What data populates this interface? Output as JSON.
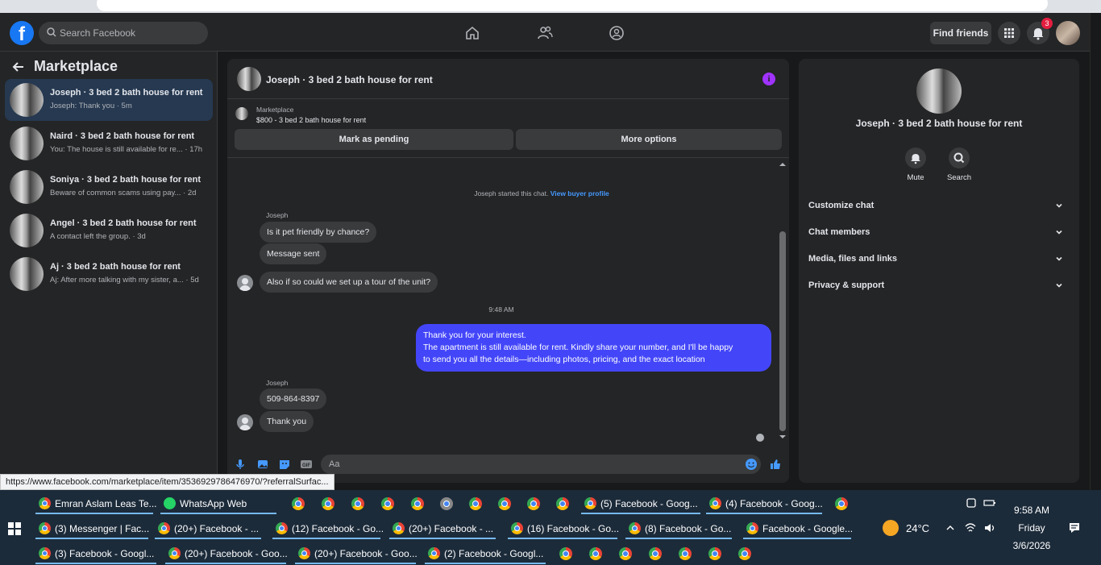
{
  "header": {
    "search_placeholder": "Search Facebook",
    "find_friends": "Find friends",
    "notification_count": "3"
  },
  "sidebar": {
    "title": "Marketplace",
    "items": [
      {
        "name": "Joseph · 3 bed 2 bath house for rent",
        "preview": "Joseph: Thank you · 5m"
      },
      {
        "name": "Naird · 3 bed 2 bath house for rent",
        "preview": "You: The house is still available for re... · 17h"
      },
      {
        "name": "Soniya · 3 bed 2 bath house for rent",
        "preview": "Beware of common scams using pay... · 2d"
      },
      {
        "name": "Angel · 3 bed 2 bath house for rent",
        "preview": "A contact left the group. · 3d"
      },
      {
        "name": "Aj · 3 bed 2 bath house for rent",
        "preview": "Aj: After more talking with my sister, a... · 5d"
      }
    ]
  },
  "chat": {
    "title": "Joseph · 3 bed 2 bath house for rent",
    "marketplace_label": "Marketplace",
    "listing": "$800 - 3 bed 2 bath house for rent",
    "mark_pending": "Mark as pending",
    "more_options": "More options",
    "system_text": "Joseph started this chat.",
    "system_link": "View buyer profile",
    "sender1": "Joseph",
    "msg1": "Is it pet friendly by chance?",
    "msg2": "Message sent",
    "msg3": "Also if so could we set up a tour of the unit?",
    "timestamp": "9:48 AM",
    "outgoing_1": "Thank you for your interest.",
    "outgoing_2": "The apartment is still available for rent. Kindly share your number, and I'll be happy",
    "outgoing_3": "to send you all the details—including photos, pricing, and the exact location",
    "sender2": "Joseph",
    "msg4": "509-864-8397",
    "msg5": "Thank you",
    "composer_placeholder": "Aa"
  },
  "details": {
    "name": "Joseph · 3 bed 2 bath house for rent",
    "mute": "Mute",
    "search": "Search",
    "sections": [
      "Customize chat",
      "Chat members",
      "Media, files and links",
      "Privacy & support"
    ]
  },
  "status_url": "https://www.facebook.com/marketplace/item/3536929786476970/?referralSurfac...",
  "taskbar": {
    "row1": [
      {
        "label": "Emran Aslam Leas Te..."
      },
      {
        "label": "WhatsApp Web"
      },
      {
        "label": "(5) Facebook - Goog..."
      },
      {
        "label": "(4) Facebook - Goog..."
      }
    ],
    "row2": [
      {
        "label": "(3) Messenger | Fac..."
      },
      {
        "label": "(20+) Facebook - ..."
      },
      {
        "label": "(12) Facebook - Go..."
      },
      {
        "label": "(20+) Facebook - ..."
      },
      {
        "label": "(16) Facebook - Go..."
      },
      {
        "label": "(8) Facebook - Go..."
      },
      {
        "label": "Facebook - Google..."
      }
    ],
    "row3": [
      {
        "label": "(3) Facebook - Googl..."
      },
      {
        "label": "(20+) Facebook - Goo..."
      },
      {
        "label": "(20+) Facebook - Goo..."
      },
      {
        "label": "(2) Facebook - Googl..."
      }
    ],
    "temperature": "24°C",
    "time": "9:58 AM",
    "day": "Friday",
    "date": "3/6/2026"
  },
  "colors": {
    "accent": "#1877f2",
    "outgoing_bubble": "#4346f8",
    "info": "#a033ff"
  }
}
